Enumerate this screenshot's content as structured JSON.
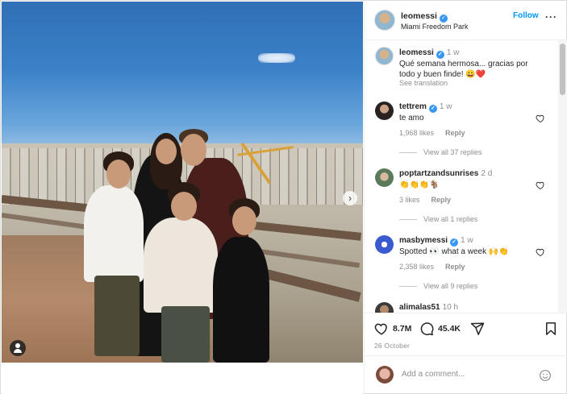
{
  "post": {
    "author": "leomessi",
    "location": "Miami Freedom Park",
    "follow_label": "Follow",
    "more_label": "···"
  },
  "photo": {
    "next_label": "›"
  },
  "comments": [
    {
      "user": "leomessi",
      "time": "1 w",
      "verified": true,
      "text": "Qué semana hermosa... gracias por todo y buen finde! 😀❤️",
      "see_translation": "See translation"
    },
    {
      "user": "tettrem",
      "time": "1 w",
      "verified": true,
      "text": "te amo",
      "likes": "1,968 likes",
      "reply": "Reply",
      "view_replies": "View all 37 replies"
    },
    {
      "user": "poptartzandsunrises",
      "time": "2 d",
      "verified": false,
      "text": "👏👏👏🐐",
      "likes": "3 likes",
      "reply": "Reply",
      "view_replies": "View all 1 replies"
    },
    {
      "user": "masbymessi",
      "time": "1 w",
      "verified": true,
      "text": "Spotted 👀 what a week 🙌👏",
      "likes": "2,358 likes",
      "reply": "Reply",
      "view_replies": "View all 9 replies"
    },
    {
      "user": "alimalas51",
      "time": "10 h",
      "verified": false
    }
  ],
  "actions": {
    "likes_count": "8.7M",
    "comments_count": "45.4K",
    "date": "26 October"
  },
  "add_comment": {
    "placeholder": "Add a comment..."
  },
  "colors": {
    "link": "#0095f6",
    "verified": "#3897f0",
    "muted": "#8e8e8e",
    "text": "#262626"
  }
}
